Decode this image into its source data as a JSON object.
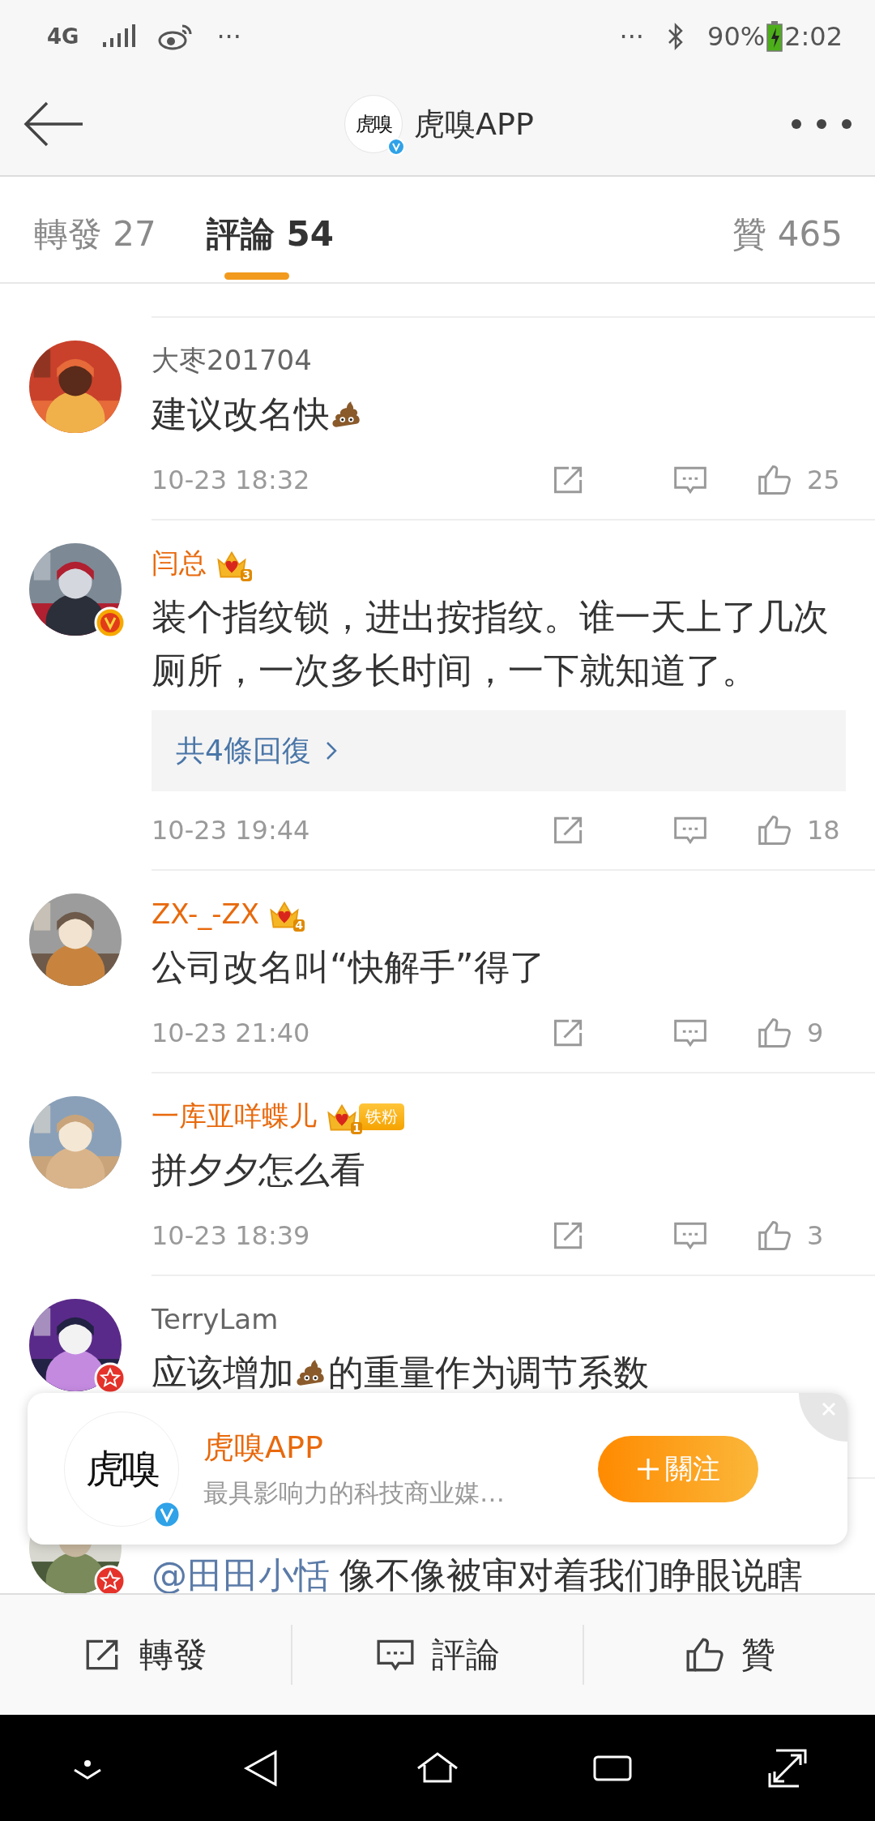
{
  "status_bar": {
    "network": "4G",
    "left_more": "···",
    "right_more": "···",
    "battery": "90%",
    "time": "2:02"
  },
  "header": {
    "logo_text": "虎嗅",
    "title": "虎嗅APP"
  },
  "tabs": [
    {
      "label": "轉發",
      "count": "27",
      "selected": false
    },
    {
      "label": "評論",
      "count": "54",
      "selected": true
    },
    {
      "label": "贊",
      "count": "465",
      "selected": false
    }
  ],
  "comments": [
    {
      "name": "大枣201704",
      "vip": false,
      "parts": [
        {
          "kind": "text",
          "text": "建议改名快"
        },
        {
          "kind": "emoji"
        }
      ],
      "time": "10-23 18:32",
      "likes": "25"
    },
    {
      "name": "闫总",
      "vip": true,
      "crown": true,
      "crown_level": "3",
      "avatar_badge": {
        "kind": "v"
      },
      "parts": [
        {
          "kind": "text",
          "text": "装个指纹锁，进出按指纹。谁一天上了几次厕所，一次多长时间，一下就知道了。"
        }
      ],
      "replies": "共4條回復",
      "time": "10-23 19:44",
      "likes": "18"
    },
    {
      "name": "ZX-_-ZX",
      "vip": true,
      "crown": true,
      "crown_level": "4",
      "parts": [
        {
          "kind": "text",
          "text": "公司改名叫“快解手”得了"
        }
      ],
      "time": "10-23 21:40",
      "likes": "9"
    },
    {
      "name": "一库亚咩蝶儿",
      "vip": true,
      "crown": true,
      "crown_level": "1",
      "fan_badge": "铁粉",
      "parts": [
        {
          "kind": "text",
          "text": "拼夕夕怎么看"
        }
      ],
      "time": "10-23 18:39",
      "likes": "3"
    },
    {
      "name": "TerryLam",
      "vip": false,
      "avatar_badge": {
        "kind": "star"
      },
      "parts": [
        {
          "kind": "text",
          "text": "应该增加"
        },
        {
          "kind": "emoji"
        },
        {
          "kind": "text",
          "text": "的重量作为调节系数"
        }
      ]
    },
    {
      "avatar_badge": {
        "kind": "star"
      },
      "parts": [
        {
          "kind": "mention",
          "text": "@田田小恬"
        },
        {
          "kind": "text",
          "text": "像不像被审对着我们睁眼说瞎"
        }
      ]
    }
  ],
  "popup": {
    "logo_text": "虎嗅",
    "title": "虎嗅APP",
    "subtitle": "最具影响力的科技商业媒…",
    "follow_label": "關注"
  },
  "bottom_bar": [
    {
      "kind": "repost",
      "label": "轉發"
    },
    {
      "kind": "comment",
      "label": "評論"
    },
    {
      "kind": "like",
      "label": "贊"
    }
  ]
}
